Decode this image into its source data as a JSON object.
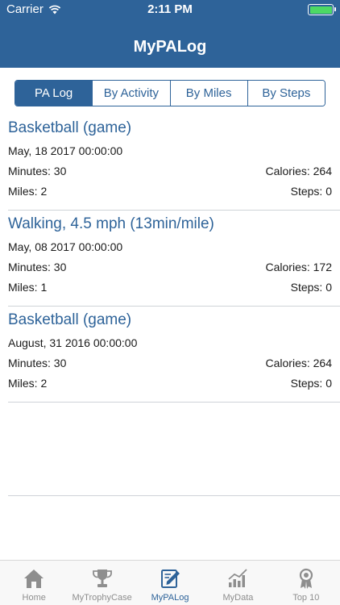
{
  "status_bar": {
    "carrier": "Carrier",
    "time": "2:11 PM"
  },
  "nav": {
    "title": "MyPALog"
  },
  "segments": [
    {
      "label": "PA Log",
      "active": true
    },
    {
      "label": "By Activity",
      "active": false
    },
    {
      "label": "By Miles",
      "active": false
    },
    {
      "label": "By Steps",
      "active": false
    }
  ],
  "entries": [
    {
      "title": "Basketball (game)",
      "date": "May, 18 2017 00:00:00",
      "minutes": "Minutes: 30",
      "calories": "Calories: 264",
      "miles": "Miles: 2",
      "steps": "Steps: 0"
    },
    {
      "title": "Walking, 4.5 mph (13min/mile)",
      "date": "May, 08 2017 00:00:00",
      "minutes": "Minutes: 30",
      "calories": "Calories: 172",
      "miles": "Miles: 1",
      "steps": "Steps: 0"
    },
    {
      "title": "Basketball (game)",
      "date": "August, 31 2016 00:00:00",
      "minutes": "Minutes: 30",
      "calories": "Calories: 264",
      "miles": "Miles: 2",
      "steps": "Steps: 0"
    }
  ],
  "tabs": [
    {
      "label": "Home",
      "icon": "home-icon",
      "active": false
    },
    {
      "label": "MyTrophyCase",
      "icon": "trophy-icon",
      "active": false
    },
    {
      "label": "MyPALog",
      "icon": "log-edit-icon",
      "active": true
    },
    {
      "label": "MyData",
      "icon": "chart-icon",
      "active": false
    },
    {
      "label": "Top 10",
      "icon": "award-icon",
      "active": false
    }
  ],
  "colors": {
    "brand": "#2e6399",
    "battery": "#4cd964",
    "tab_inactive": "#8e8e8e"
  }
}
